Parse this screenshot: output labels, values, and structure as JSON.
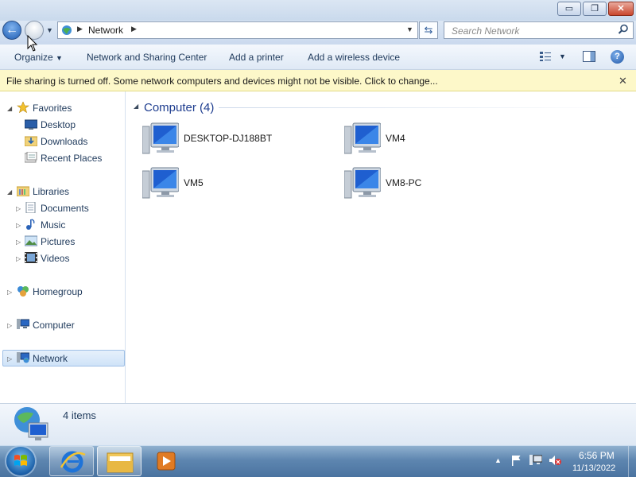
{
  "window": {
    "minimize_label": "▭",
    "maximize_label": "❐",
    "close_label": "✕"
  },
  "address": {
    "location": "Network",
    "search_placeholder": "Search Network"
  },
  "toolbar": {
    "organize": "Organize",
    "network_center": "Network and Sharing Center",
    "add_printer": "Add a printer",
    "add_wireless": "Add a wireless device",
    "help": "?"
  },
  "infobar": {
    "message": "File sharing is turned off. Some network computers and devices might not be visible. Click to change..."
  },
  "nav": {
    "favorites": "Favorites",
    "desktop": "Desktop",
    "downloads": "Downloads",
    "recent_places": "Recent Places",
    "libraries": "Libraries",
    "documents": "Documents",
    "music": "Music",
    "pictures": "Pictures",
    "videos": "Videos",
    "homegroup": "Homegroup",
    "computer": "Computer",
    "network": "Network"
  },
  "content": {
    "group_header": "Computer (4)",
    "computers": [
      "DESKTOP-DJ188BT",
      "VM4",
      "VM5",
      "VM8-PC"
    ]
  },
  "details": {
    "item_count": "4 items"
  },
  "taskbar": {
    "time": "6:56 PM",
    "date": "11/13/2022"
  },
  "colors": {
    "accent": "#1e3d8f",
    "infobar_bg": "#fdf8c9",
    "selection_bg": "#cfe3f8",
    "taskbar": "#4a73a0"
  },
  "icons": [
    "back-arrow-icon",
    "forward-arrow-icon",
    "network-icon",
    "refresh-icon",
    "search-icon",
    "views-icon",
    "preview-pane-icon",
    "help-icon",
    "star-icon",
    "desktop-icon",
    "downloads-folder-icon",
    "recent-places-icon",
    "libraries-icon",
    "documents-icon",
    "music-icon",
    "pictures-icon",
    "videos-icon",
    "homegroup-icon",
    "computer-icon",
    "start-orb-icon",
    "internet-explorer-icon",
    "explorer-folder-icon",
    "media-player-icon",
    "action-center-flag-icon",
    "network-tray-icon",
    "volume-muted-icon"
  ]
}
